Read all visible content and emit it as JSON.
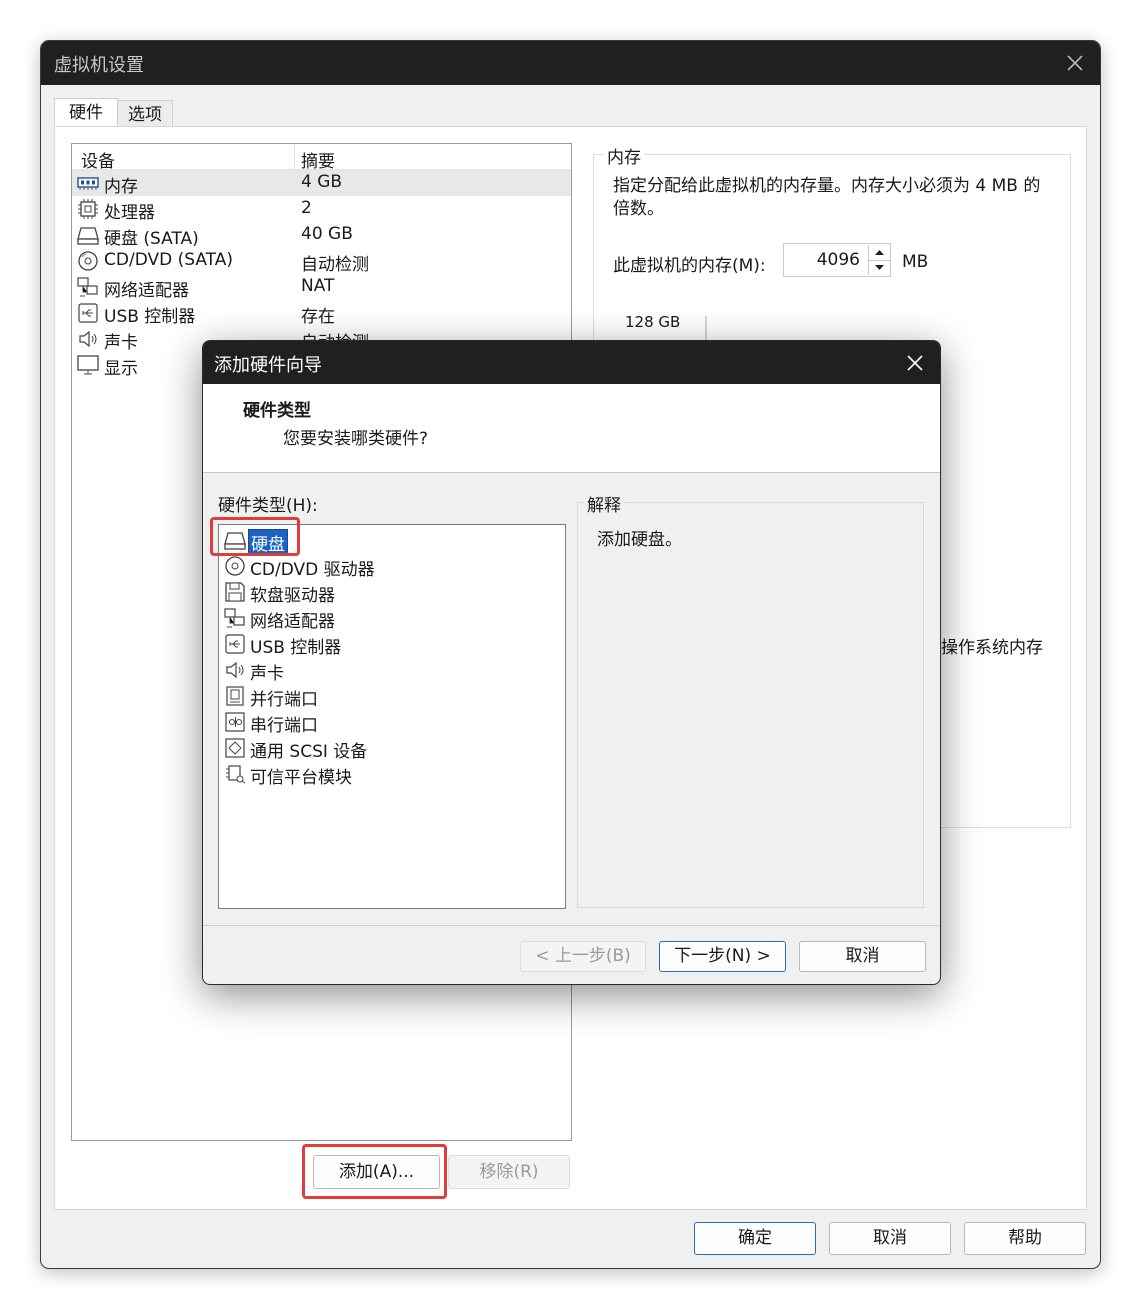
{
  "window": {
    "title": "虚拟机设置",
    "tabs": [
      {
        "label": "硬件"
      },
      {
        "label": "选项"
      }
    ],
    "device_list": {
      "headers": [
        "设备",
        "摘要"
      ],
      "rows": [
        {
          "icon": "memory-icon",
          "name": "内存",
          "summary": "4 GB"
        },
        {
          "icon": "cpu-icon",
          "name": "处理器",
          "summary": "2"
        },
        {
          "icon": "hard-disk-icon",
          "name": "硬盘 (SATA)",
          "summary": "40 GB"
        },
        {
          "icon": "cd-dvd-icon",
          "name": "CD/DVD (SATA)",
          "summary": "自动检测"
        },
        {
          "icon": "network-icon",
          "name": "网络适配器",
          "summary": "NAT"
        },
        {
          "icon": "usb-icon",
          "name": "USB 控制器",
          "summary": "存在"
        },
        {
          "icon": "speaker-icon",
          "name": "声卡",
          "summary": "自动检测"
        },
        {
          "icon": "monitor-icon",
          "name": "显示",
          "summary": ""
        }
      ],
      "selected_index": 0
    },
    "add_button": "添加(A)...",
    "remove_button": "移除(R)",
    "memory": {
      "title": "内存",
      "description": "指定分配给此虚拟机的内存量。内存大小必须为 4 MB 的倍数。",
      "field_label": "此虚拟机的内存(M):",
      "value": "4096",
      "unit": "MB",
      "scale_label": "128 GB",
      "partial_text": "操作系统内存"
    },
    "buttons": {
      "ok": "确定",
      "cancel": "取消",
      "help": "帮助"
    }
  },
  "wizard": {
    "title": "添加硬件向导",
    "heading": "硬件类型",
    "subheading": "您要安装哪类硬件?",
    "list_label": "硬件类型(H):",
    "items": [
      {
        "icon": "hard-disk-icon",
        "label": "硬盘"
      },
      {
        "icon": "cd-dvd-icon",
        "label": "CD/DVD 驱动器"
      },
      {
        "icon": "floppy-icon",
        "label": "软盘驱动器"
      },
      {
        "icon": "network-icon",
        "label": "网络适配器"
      },
      {
        "icon": "usb-icon",
        "label": "USB 控制器"
      },
      {
        "icon": "speaker-icon",
        "label": "声卡"
      },
      {
        "icon": "parallel-port-icon",
        "label": "并行端口"
      },
      {
        "icon": "serial-port-icon",
        "label": "串行端口"
      },
      {
        "icon": "scsi-icon",
        "label": "通用 SCSI 设备"
      },
      {
        "icon": "tpm-icon",
        "label": "可信平台模块"
      }
    ],
    "selected_index": 0,
    "explain_title": "解释",
    "explain_text": "添加硬盘。",
    "buttons": {
      "back": "< 上一步(B)",
      "next": "下一步(N) >",
      "cancel": "取消"
    }
  },
  "colors": {
    "highlight": "#e03c3c",
    "selection": "#1c63c8",
    "titlebar": "#202020"
  }
}
